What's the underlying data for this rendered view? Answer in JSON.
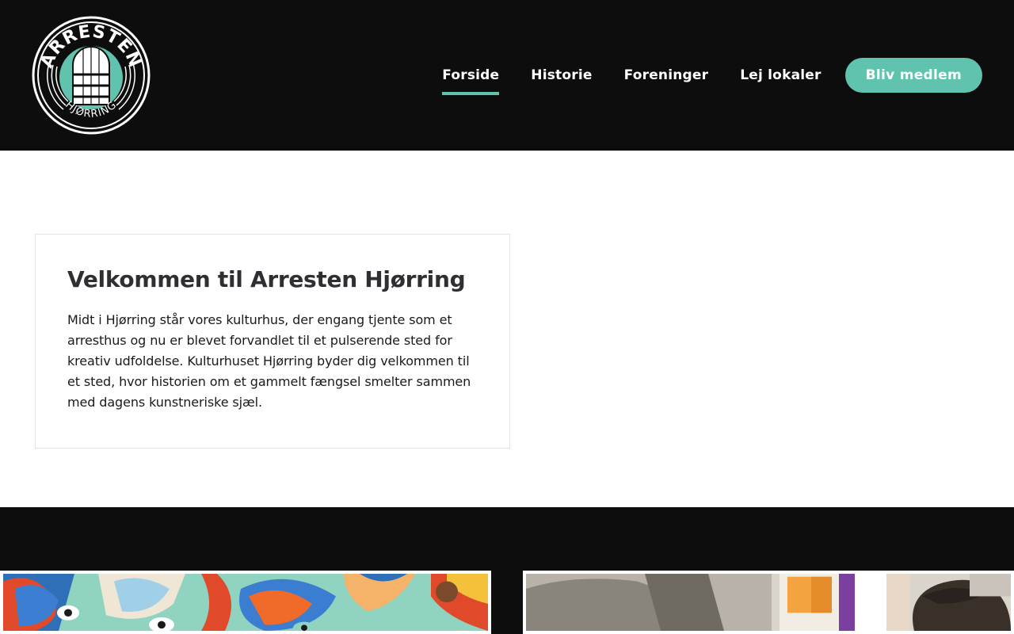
{
  "header": {
    "logo": {
      "top_text": "ARRESTEN",
      "bottom_text": "HJØRRING"
    },
    "nav": [
      {
        "label": "Forside",
        "active": true
      },
      {
        "label": "Historie",
        "active": false
      },
      {
        "label": "Foreninger",
        "active": false
      },
      {
        "label": "Lej lokaler",
        "active": false
      }
    ],
    "cta_label": "Bliv medlem"
  },
  "intro": {
    "title": "Velkommen til Arresten Hjørring",
    "text": "Midt i Hjørring står vores kulturhus, der engang tjente som et arresthus og nu er blevet forvandlet til et pulserende sted for kreativ udfoldelse. Kulturhuset Hjørring byder dig velkommen til et sted, hvor historien om et gammelt fængsel smelter sammen med dagens kunstneriske sjæl."
  },
  "colors": {
    "accent": "#5fc3ad",
    "header_bg": "#0d0d0d",
    "text": "#2e2e33"
  },
  "gallery": {
    "images": [
      "colorful-painting",
      "person-in-studio"
    ]
  }
}
